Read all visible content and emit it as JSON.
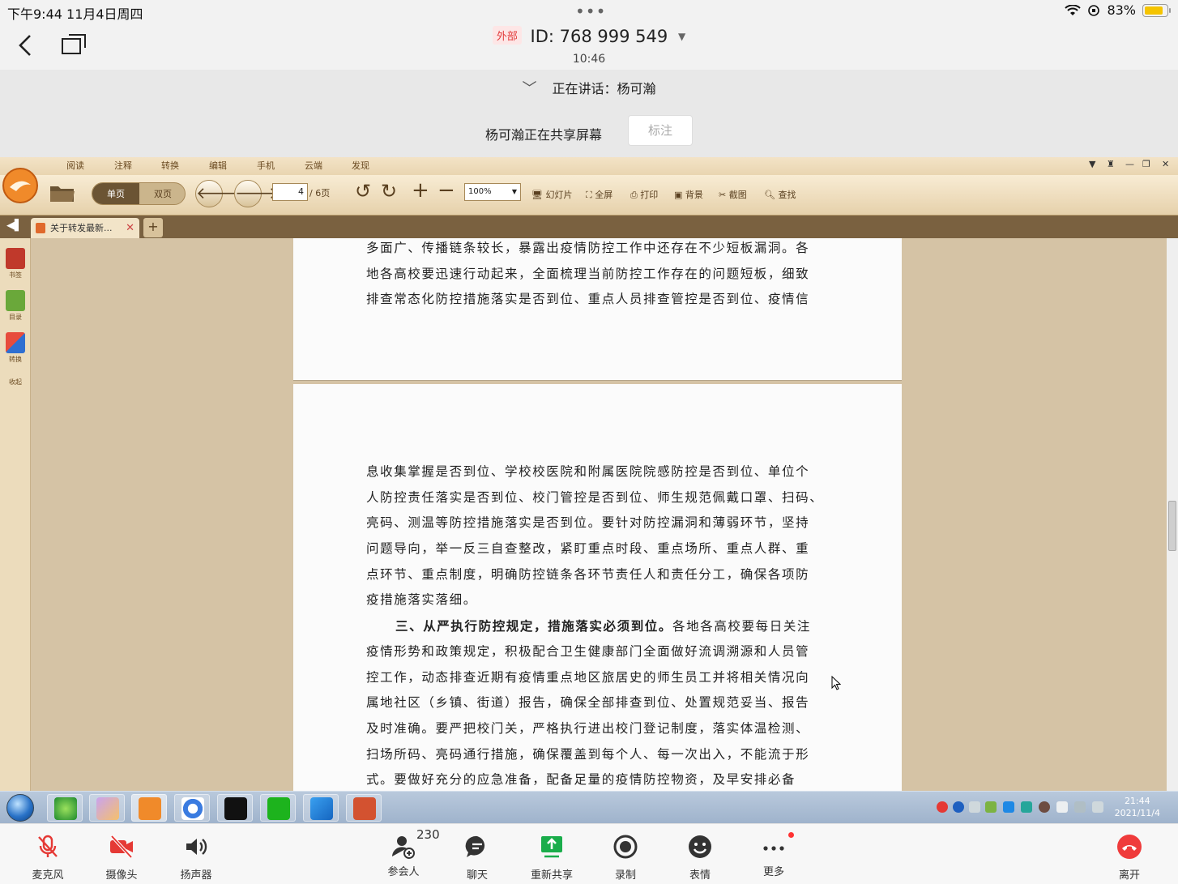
{
  "status_bar": {
    "time_date": "下午9:44   11月4日周四",
    "battery": "83%",
    "battery_level": 0.83
  },
  "meeting": {
    "badge": "外部",
    "id": "ID: 768 999 549",
    "elapsed": "10:46",
    "speaking": "正在讲话：杨可瀚",
    "sharing": "杨可瀚正在共享屏幕",
    "annotate": "标注"
  },
  "pdf_app": {
    "menu_tabs": [
      "阅读",
      "注释",
      "转换",
      "编辑",
      "手机",
      "云端",
      "发现"
    ],
    "view_single": "单页",
    "view_double": "双页",
    "page_current": "4",
    "page_total": "/ 6页",
    "zoom": "100%",
    "tools": [
      "幻灯片",
      "全屏",
      "打印",
      "背景",
      "截图",
      "查找"
    ],
    "tab_title": "关于转发最新...",
    "sidebar": [
      "书签",
      "目录",
      "转换",
      "收起"
    ]
  },
  "document": {
    "page1_lines": [
      "多面广、传播链条较长，暴露出疫情防控工作中还存在不少短板漏洞。各",
      "地各高校要迅速行动起来，全面梳理当前防控工作存在的问题短板，细致",
      "排查常态化防控措施落实是否到位、重点人员排查管控是否到位、疫情信"
    ],
    "page2_lines": [
      "息收集掌握是否到位、学校校医院和附属医院院感防控是否到位、单位个",
      "人防控责任落实是否到位、校门管控是否到位、师生规范佩戴口罩、扫码、",
      "亮码、测温等防控措施落实是否到位。要针对防控漏洞和薄弱环节，坚持",
      "问题导向，举一反三自查整改，紧盯重点时段、重点场所、重点人群、重",
      "点环节、重点制度，明确防控链条各环节责任人和责任分工，确保各项防",
      "疫措施落实落细。"
    ],
    "section_heading": "三、从严执行防控规定，措施落实必须到位。",
    "section_first_rest": "各地各高校要每日关注",
    "page2_lines_after": [
      "疫情形势和政策规定，积极配合卫生健康部门全面做好流调溯源和人员管",
      "控工作，动态排查近期有疫情重点地区旅居史的师生员工并将相关情况向",
      "属地社区（乡镇、街道）报告，确保全部排查到位、处置规范妥当、报告",
      "及时准确。要严把校门关，严格执行进出校门登记制度，落实体温检测、",
      "扫场所码、亮码通行措施，确保覆盖到每个人、每一次出入，不能流于形",
      "式。要做好充分的应急准备，配备足量的疫情防控物资，及早安排必备"
    ]
  },
  "taskbar": {
    "clock_time": "21:44",
    "clock_date": "2021/11/4"
  },
  "controls": {
    "mic": "麦克风",
    "camera": "摄像头",
    "speaker": "扬声器",
    "participants": "参会人",
    "participants_count": "230",
    "chat": "聊天",
    "reshare": "重新共享",
    "record": "录制",
    "emoji": "表情",
    "more": "更多",
    "leave": "离开"
  }
}
